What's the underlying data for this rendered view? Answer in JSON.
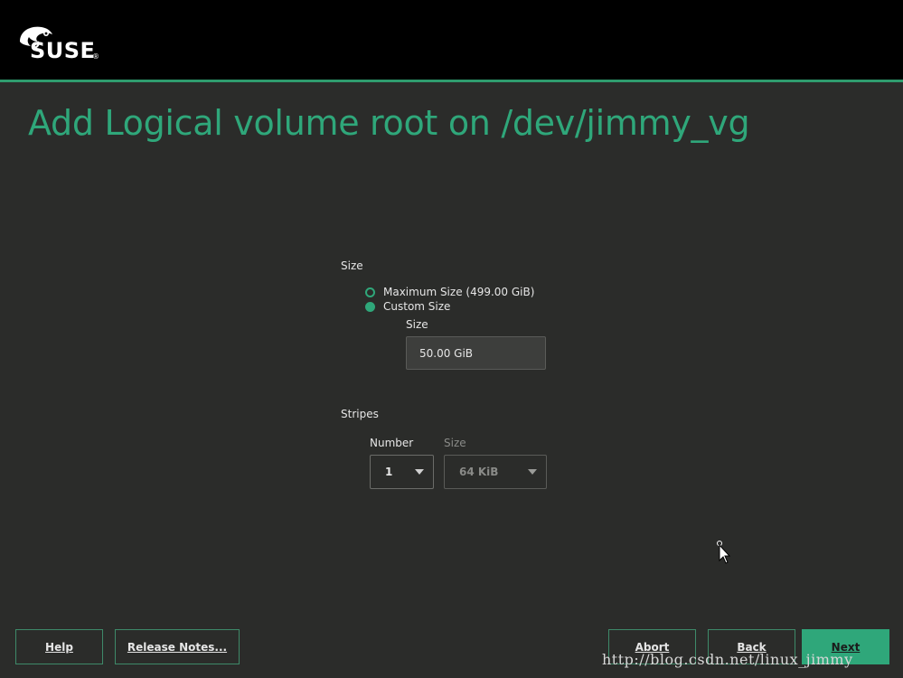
{
  "header": {
    "brand": "SUSE"
  },
  "page": {
    "title": "Add Logical volume root on /dev/jimmy_vg"
  },
  "size_section": {
    "label": "Size",
    "options": [
      {
        "label": "Maximum Size (499.00 GiB)",
        "selected": false
      },
      {
        "label": "Custom Size",
        "selected": true
      }
    ],
    "custom_size_label": "Size",
    "custom_size_value": "50.00 GiB"
  },
  "stripes_section": {
    "label": "Stripes",
    "number_label": "Number",
    "number_value": "1",
    "size_label": "Size",
    "size_value": "64 KiB",
    "size_enabled": false
  },
  "buttons": {
    "help": "Help",
    "release_notes": "Release Notes...",
    "abort": "Abort",
    "back": "Back",
    "next": "Next"
  },
  "watermark": "http://blog.csdn.net/linux_jimmy",
  "colors": {
    "accent": "#2fa77a",
    "background": "#2b2c2a",
    "header": "#000000"
  }
}
